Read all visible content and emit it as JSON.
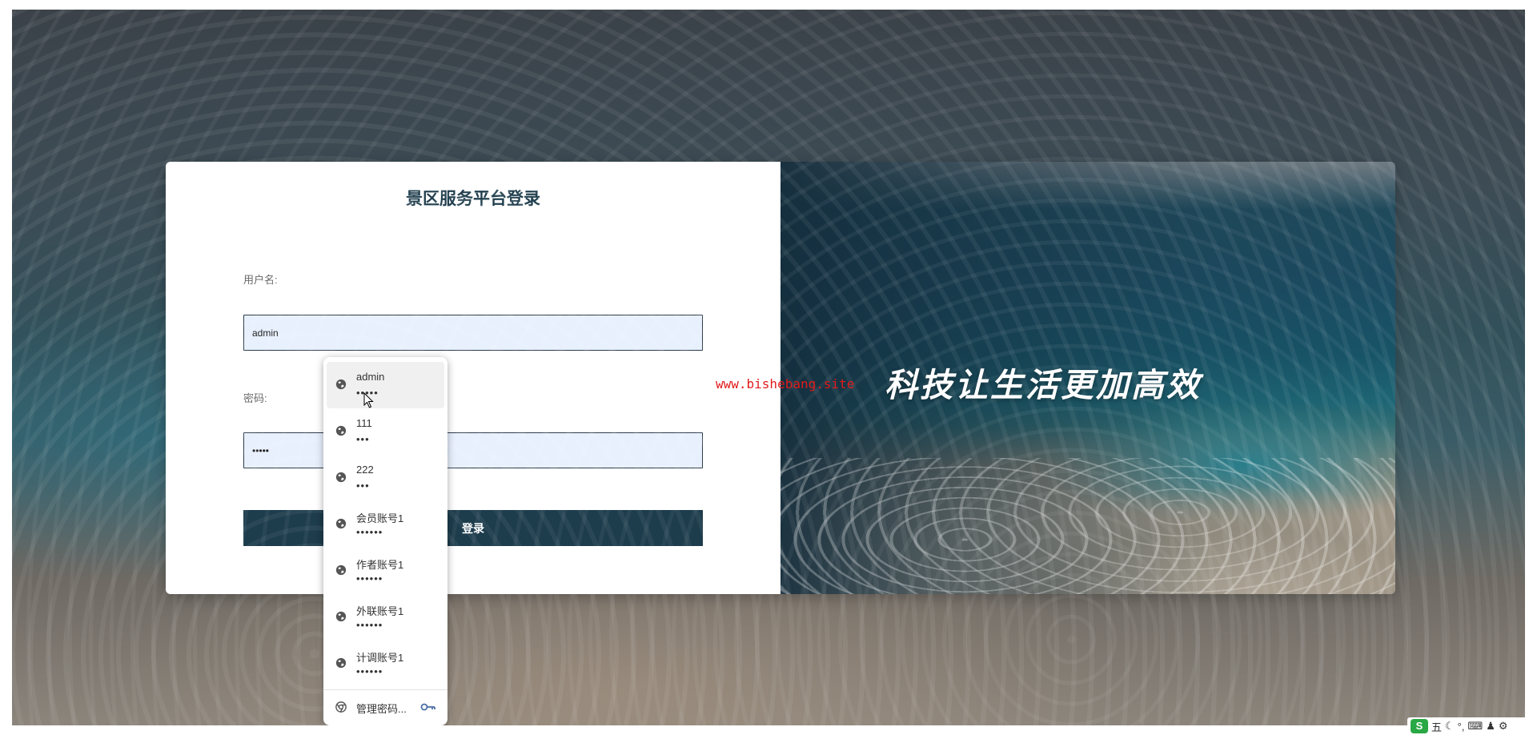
{
  "login": {
    "title": "景区服务平台登录",
    "username_label": "用户名:",
    "username_value": "admin",
    "password_label": "密码:",
    "password_value": "•••••",
    "submit_label": "登录"
  },
  "banner": {
    "slogan": "科技让生活更加高效",
    "watermark": "www.bishebang.site"
  },
  "autofill": {
    "items": [
      {
        "user": "admin",
        "pass": "•••••"
      },
      {
        "user": "111",
        "pass": "•••"
      },
      {
        "user": "222",
        "pass": "•••"
      },
      {
        "user": "会员账号1",
        "pass": "••••••"
      },
      {
        "user": "作者账号1",
        "pass": "••••••"
      },
      {
        "user": "外联账号1",
        "pass": "••••••"
      },
      {
        "user": "计调账号1",
        "pass": "••••••"
      }
    ],
    "manage_label": "管理密码..."
  },
  "tray": {
    "ime_logo": "S",
    "ime_mode": "五",
    "moon": "☾",
    "punct": "°,",
    "keyboard": "⌨",
    "user": "♟",
    "settings": "⚙"
  },
  "colors": {
    "primary": "#1d3c4c",
    "input_bg": "#e8f0fe",
    "watermark": "#e21b1b"
  }
}
